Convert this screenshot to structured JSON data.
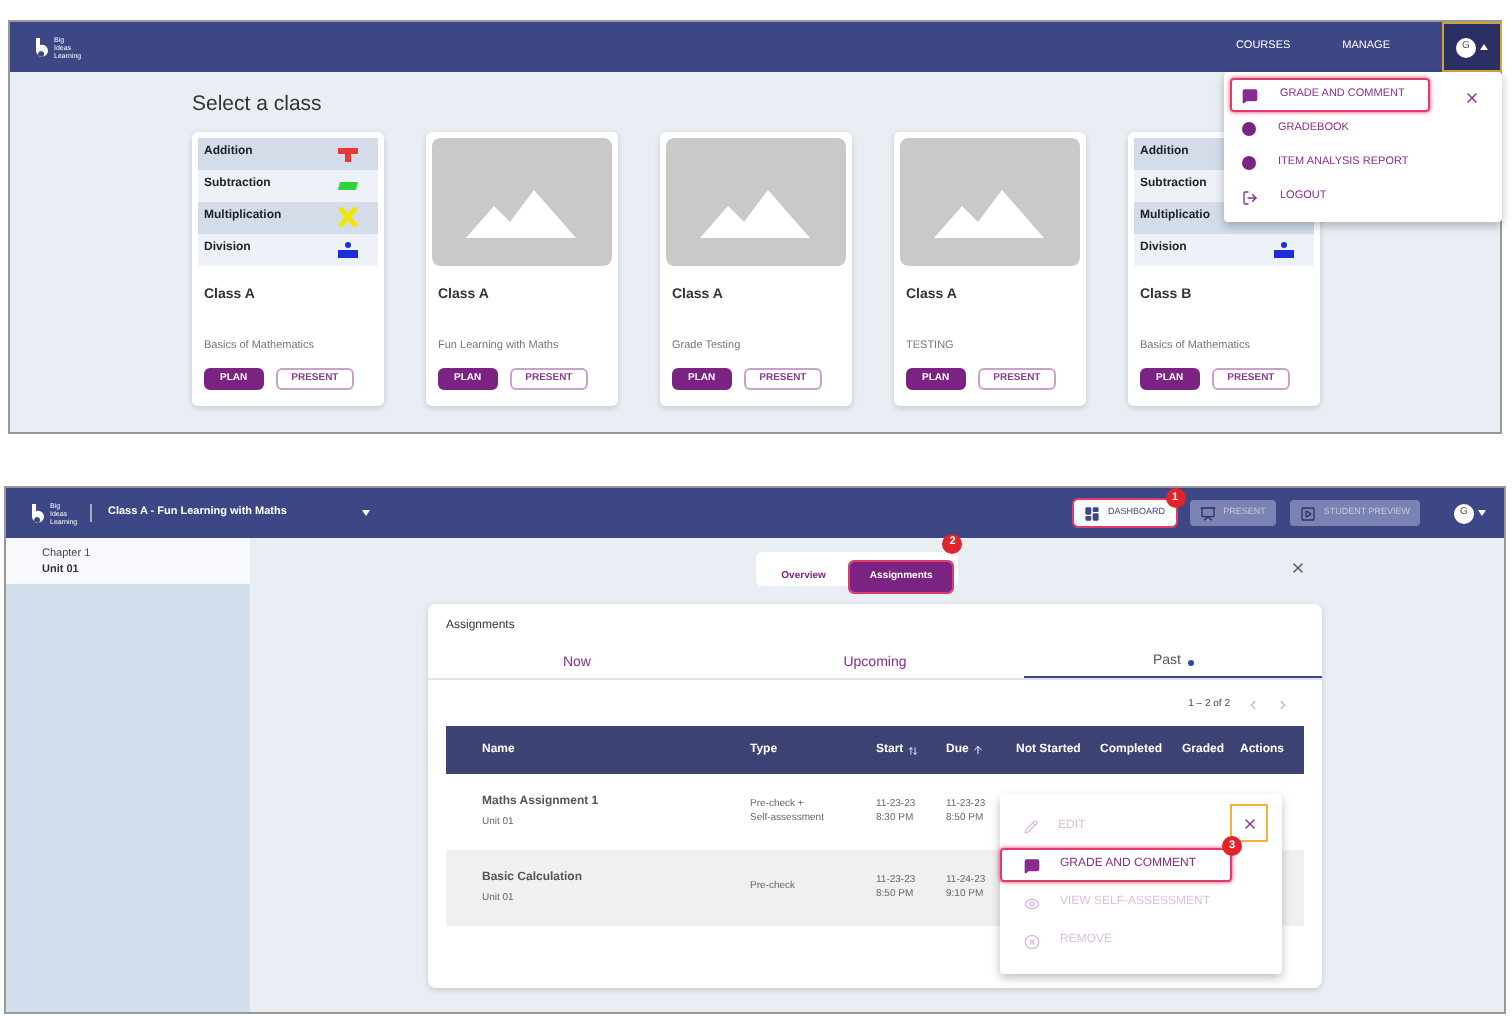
{
  "top": {
    "logo": "Big Ideas Learning",
    "nav": [
      {
        "label": "COURSES"
      },
      {
        "label": "MANAGE"
      }
    ],
    "avatar": "G",
    "heading": "Select a class",
    "classes": [
      {
        "cover": {
          "kind": "worksheet",
          "rows": [
            {
              "label": "Addition",
              "kind": "plus",
              "color": "#e53935"
            },
            {
              "label": "Subtraction",
              "kind": "minus",
              "color": "#32d336"
            },
            {
              "label": "Multiplication",
              "kind": "times",
              "color": "#f2e600"
            },
            {
              "label": "Division",
              "kind": "divide",
              "color": "#1a2fd8"
            }
          ]
        },
        "title": "Class A",
        "course": "Basics of Mathematics",
        "buttons": [
          {
            "kind": "primary",
            "label": "PLAN"
          },
          {
            "kind": "outline",
            "label": "PRESENT"
          }
        ]
      },
      {
        "cover": {
          "kind": "placeholder"
        },
        "title": "Class A",
        "course": "Fun Learning with Maths",
        "buttons": [
          {
            "kind": "primary",
            "label": "PLAN"
          },
          {
            "kind": "outline",
            "label": "PRESENT"
          }
        ]
      },
      {
        "cover": {
          "kind": "placeholder"
        },
        "title": "Class A",
        "course": "Grade Testing",
        "buttons": [
          {
            "kind": "primary",
            "label": "PLAN"
          },
          {
            "kind": "outline",
            "label": "PRESENT"
          }
        ]
      },
      {
        "cover": {
          "kind": "placeholder"
        },
        "title": "Class A",
        "course": "TESTING",
        "buttons": [
          {
            "kind": "primary",
            "label": "PLAN"
          },
          {
            "kind": "outline",
            "label": "PRESENT"
          }
        ]
      },
      {
        "cover": {
          "kind": "worksheet",
          "rows": [
            {
              "label": "Addition"
            },
            {
              "label": "Subtraction"
            },
            {
              "label": "Multiplicatio"
            },
            {
              "label": "Division",
              "kind": "divide",
              "color": "#1a2fd8"
            }
          ]
        },
        "title": "Class B",
        "course": "Basics of Mathematics",
        "buttons": [
          {
            "kind": "primary",
            "label": "PLAN"
          },
          {
            "kind": "outline",
            "label": "PRESENT"
          }
        ]
      }
    ],
    "menu": {
      "items": [
        {
          "kind": "comment",
          "label": "GRADE AND COMMENT",
          "highlighted": true
        },
        {
          "kind": "dot",
          "label": "GRADEBOOK",
          "highlighted": false
        },
        {
          "kind": "dot",
          "label": "ITEM ANALYSIS REPORT",
          "highlighted": false
        },
        {
          "kind": "logout",
          "label": "LOGOUT",
          "highlighted": false
        }
      ]
    }
  },
  "bottom": {
    "logo": "Big Ideas Learning",
    "class_title": "Class A - Fun Learning with Maths",
    "actions": [
      {
        "kind": "dashboard",
        "label": "DASHBOARD",
        "disabled": false,
        "highlighted": true,
        "badge": "1"
      },
      {
        "kind": "present",
        "label": "PRESENT",
        "disabled": true,
        "highlighted": false
      },
      {
        "kind": "preview",
        "label": "STUDENT PREVIEW",
        "disabled": true,
        "highlighted": false
      }
    ],
    "avatar": "G",
    "sidebar": {
      "items": [
        {
          "chapter": "Chapter 1",
          "unit": "Unit 01",
          "selected": true
        }
      ]
    },
    "view_tabs": [
      {
        "label": "Overview",
        "selected": false,
        "highlighted": false
      },
      {
        "label": "Assignments",
        "selected": true,
        "highlighted": true,
        "badge": "2"
      }
    ],
    "card": {
      "title": "Assignments",
      "tabs": [
        {
          "label": "Now",
          "selected": false,
          "dot": false
        },
        {
          "label": "Upcoming",
          "selected": false,
          "dot": false
        },
        {
          "label": "Past",
          "selected": true,
          "dot": true
        }
      ],
      "pagination": "1 – 2 of 2",
      "table": {
        "columns": [
          {
            "label": "Name",
            "kind": "plain"
          },
          {
            "label": "Type",
            "kind": "plain"
          },
          {
            "label": "Start",
            "kind": "sort_both"
          },
          {
            "label": "Due",
            "kind": "sort_up"
          },
          {
            "label": "Not Started",
            "kind": "plain"
          },
          {
            "label": "Completed",
            "kind": "plain"
          },
          {
            "label": "Graded",
            "kind": "plain"
          },
          {
            "label": "Actions",
            "kind": "plain"
          }
        ],
        "rows": [
          {
            "name": "Maths Assignment 1",
            "unit": "Unit 01",
            "type": "Pre-check +\nSelf-assessment",
            "start": "11-23-23\n8:30 PM",
            "due": "11-23-23\n8:50 PM"
          },
          {
            "name": "Basic Calculation",
            "unit": "Unit 01",
            "type": "Pre-check",
            "start": "11-23-23\n8:50 PM",
            "due": "11-24-23\n9:10 PM"
          }
        ]
      },
      "actions_menu": {
        "items": [
          {
            "kind": "edit",
            "label": "EDIT",
            "disabled": true,
            "highlighted": false
          },
          {
            "kind": "comment",
            "label": "GRADE AND COMMENT",
            "disabled": false,
            "highlighted": true,
            "badge": "3"
          },
          {
            "kind": "eye",
            "label": "VIEW SELF-ASSESSMENT",
            "disabled": true,
            "highlighted": false
          },
          {
            "kind": "remove",
            "label": "REMOVE",
            "disabled": true,
            "highlighted": false
          }
        ]
      }
    }
  }
}
